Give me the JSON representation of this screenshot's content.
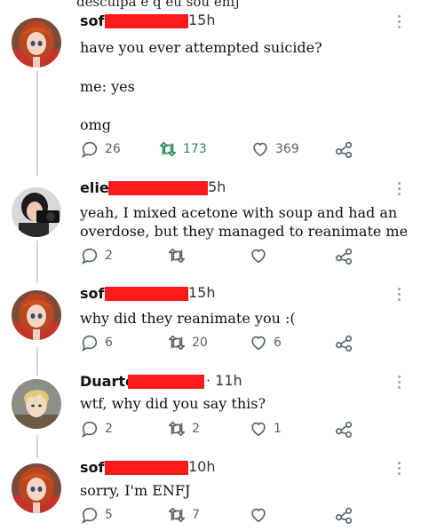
{
  "top_cut_text": "desculpa é q eu sou enfj",
  "posts": [
    {
      "author": "sof",
      "time": "15h",
      "lines": [
        "have you ever attempted suicide?",
        "me: yes",
        "omg"
      ],
      "replies": "26",
      "retweets": "173",
      "likes": "369",
      "avatar": "red-hair-anime-girl"
    },
    {
      "author": "elie",
      "time": "5h",
      "lines": [
        "yeah, I mixed acetone with soup and had an overdose, but they managed to reanimate me"
      ],
      "replies": "2",
      "retweets": "",
      "likes": "",
      "avatar": "woman-with-camera"
    },
    {
      "author": "sof",
      "time": "15h",
      "lines": [
        "why did they reanimate you :("
      ],
      "replies": "6",
      "retweets": "20",
      "likes": "6",
      "avatar": "red-hair-anime-girl"
    },
    {
      "author": "Duarte",
      "time": "· 11h",
      "lines": [
        "wtf, why did you say this?"
      ],
      "replies": "2",
      "retweets": "2",
      "likes": "1",
      "avatar": "blond-anime-boy"
    },
    {
      "author": "sof",
      "time": "10h",
      "lines": [
        "sorry, I'm ENFJ"
      ],
      "replies": "5",
      "retweets": "7",
      "likes": "",
      "avatar": "red-hair-anime-girl"
    }
  ],
  "icons": {
    "reply": "reply-icon",
    "retweet": "retweet-icon",
    "like": "heart-icon",
    "share": "share-icon",
    "more": "more-vertical-icon"
  },
  "colors": {
    "redaction": "#ff1a1a",
    "retweet_green": "#2a8a57",
    "icon_gray": "#58636b",
    "thread_line": "#cfd5da"
  }
}
